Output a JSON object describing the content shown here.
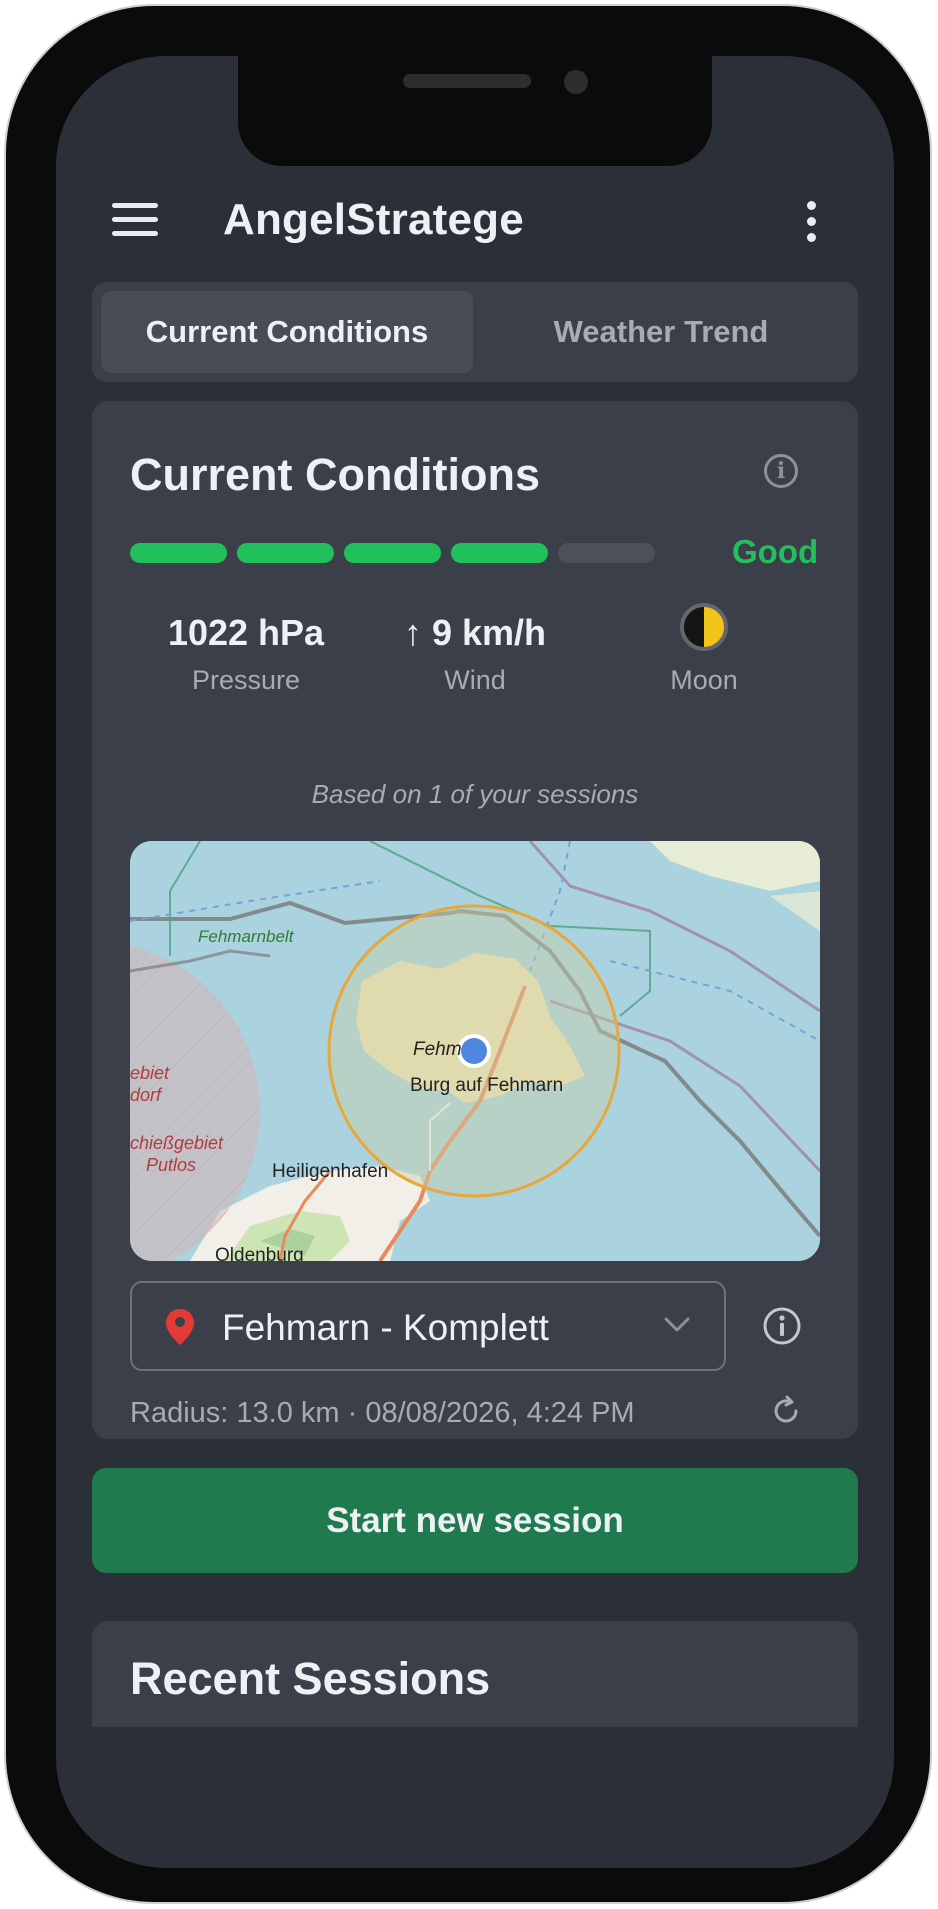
{
  "app": {
    "title": "AngelStratege"
  },
  "tabs": [
    {
      "label": "Current Conditions",
      "active": true
    },
    {
      "label": "Weather Trend",
      "active": false
    }
  ],
  "conditions": {
    "title": "Current Conditions",
    "rating": {
      "filled_segments": 4,
      "total_segments": 5,
      "label": "Good",
      "color": "#22c05a"
    },
    "pressure": {
      "value": "1022 hPa",
      "label": "Pressure"
    },
    "wind": {
      "value": "9 km/h",
      "arrow": "↑",
      "label": "Wind"
    },
    "moon": {
      "label": "Moon"
    },
    "based_on": "Based on 1 of your sessions"
  },
  "map": {
    "labels": {
      "fehmarnbelt": "Fehmarnbelt",
      "fehm": "Fehm",
      "burg": "Burg auf Fehmarn",
      "heiligenhafen": "Heiligenhafen",
      "oldenburg": "Oldenburg",
      "gebiet": "ebiet",
      "dorf": "dorf",
      "schiess": "chießgebiet",
      "putlos": "Putlos"
    }
  },
  "location": {
    "name": "Fehmarn - Komplett",
    "meta": "Radius: 13.0 km  ·  08/08/2026, 4:24 PM"
  },
  "actions": {
    "start_session": "Start new session"
  },
  "recent": {
    "title": "Recent Sessions"
  },
  "colors": {
    "background": "#2a2f38",
    "card": "#3a3f49",
    "accent_green": "#22c05a",
    "button_green": "#1f7a4d",
    "pin_red": "#e53935",
    "marker_blue": "#4f86e0"
  }
}
